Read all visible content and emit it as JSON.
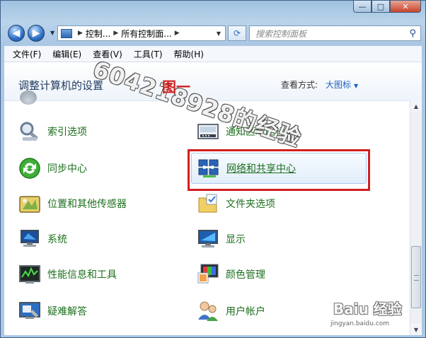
{
  "breadcrumb": [
    "控制...",
    "所有控制面..."
  ],
  "search": {
    "placeholder": "搜索控制面板"
  },
  "menu": [
    "文件(F)",
    "编辑(E)",
    "查看(V)",
    "工具(T)",
    "帮助(H)"
  ],
  "page_title": "调整计算机的设置",
  "view_by": {
    "label": "查看方式:",
    "value": "大图标"
  },
  "items_left": [
    "索引选项",
    "同步中心",
    "位置和其他传感器",
    "系统",
    "性能信息和工具",
    "疑难解答"
  ],
  "items_right": [
    "通知区域图标",
    "网络和共享中心",
    "文件夹选项",
    "显示",
    "颜色管理",
    "用户帐户"
  ],
  "watermark": {
    "text": "604218928的经验",
    "figure_label": "图一",
    "baidu": "Baiu 经验",
    "baidu_sub": "jingyan.baidu.com"
  },
  "colors": {
    "accent": "#1d5fbf",
    "item_text": "#1d6f1d",
    "highlight_box": "#d11f1f"
  }
}
